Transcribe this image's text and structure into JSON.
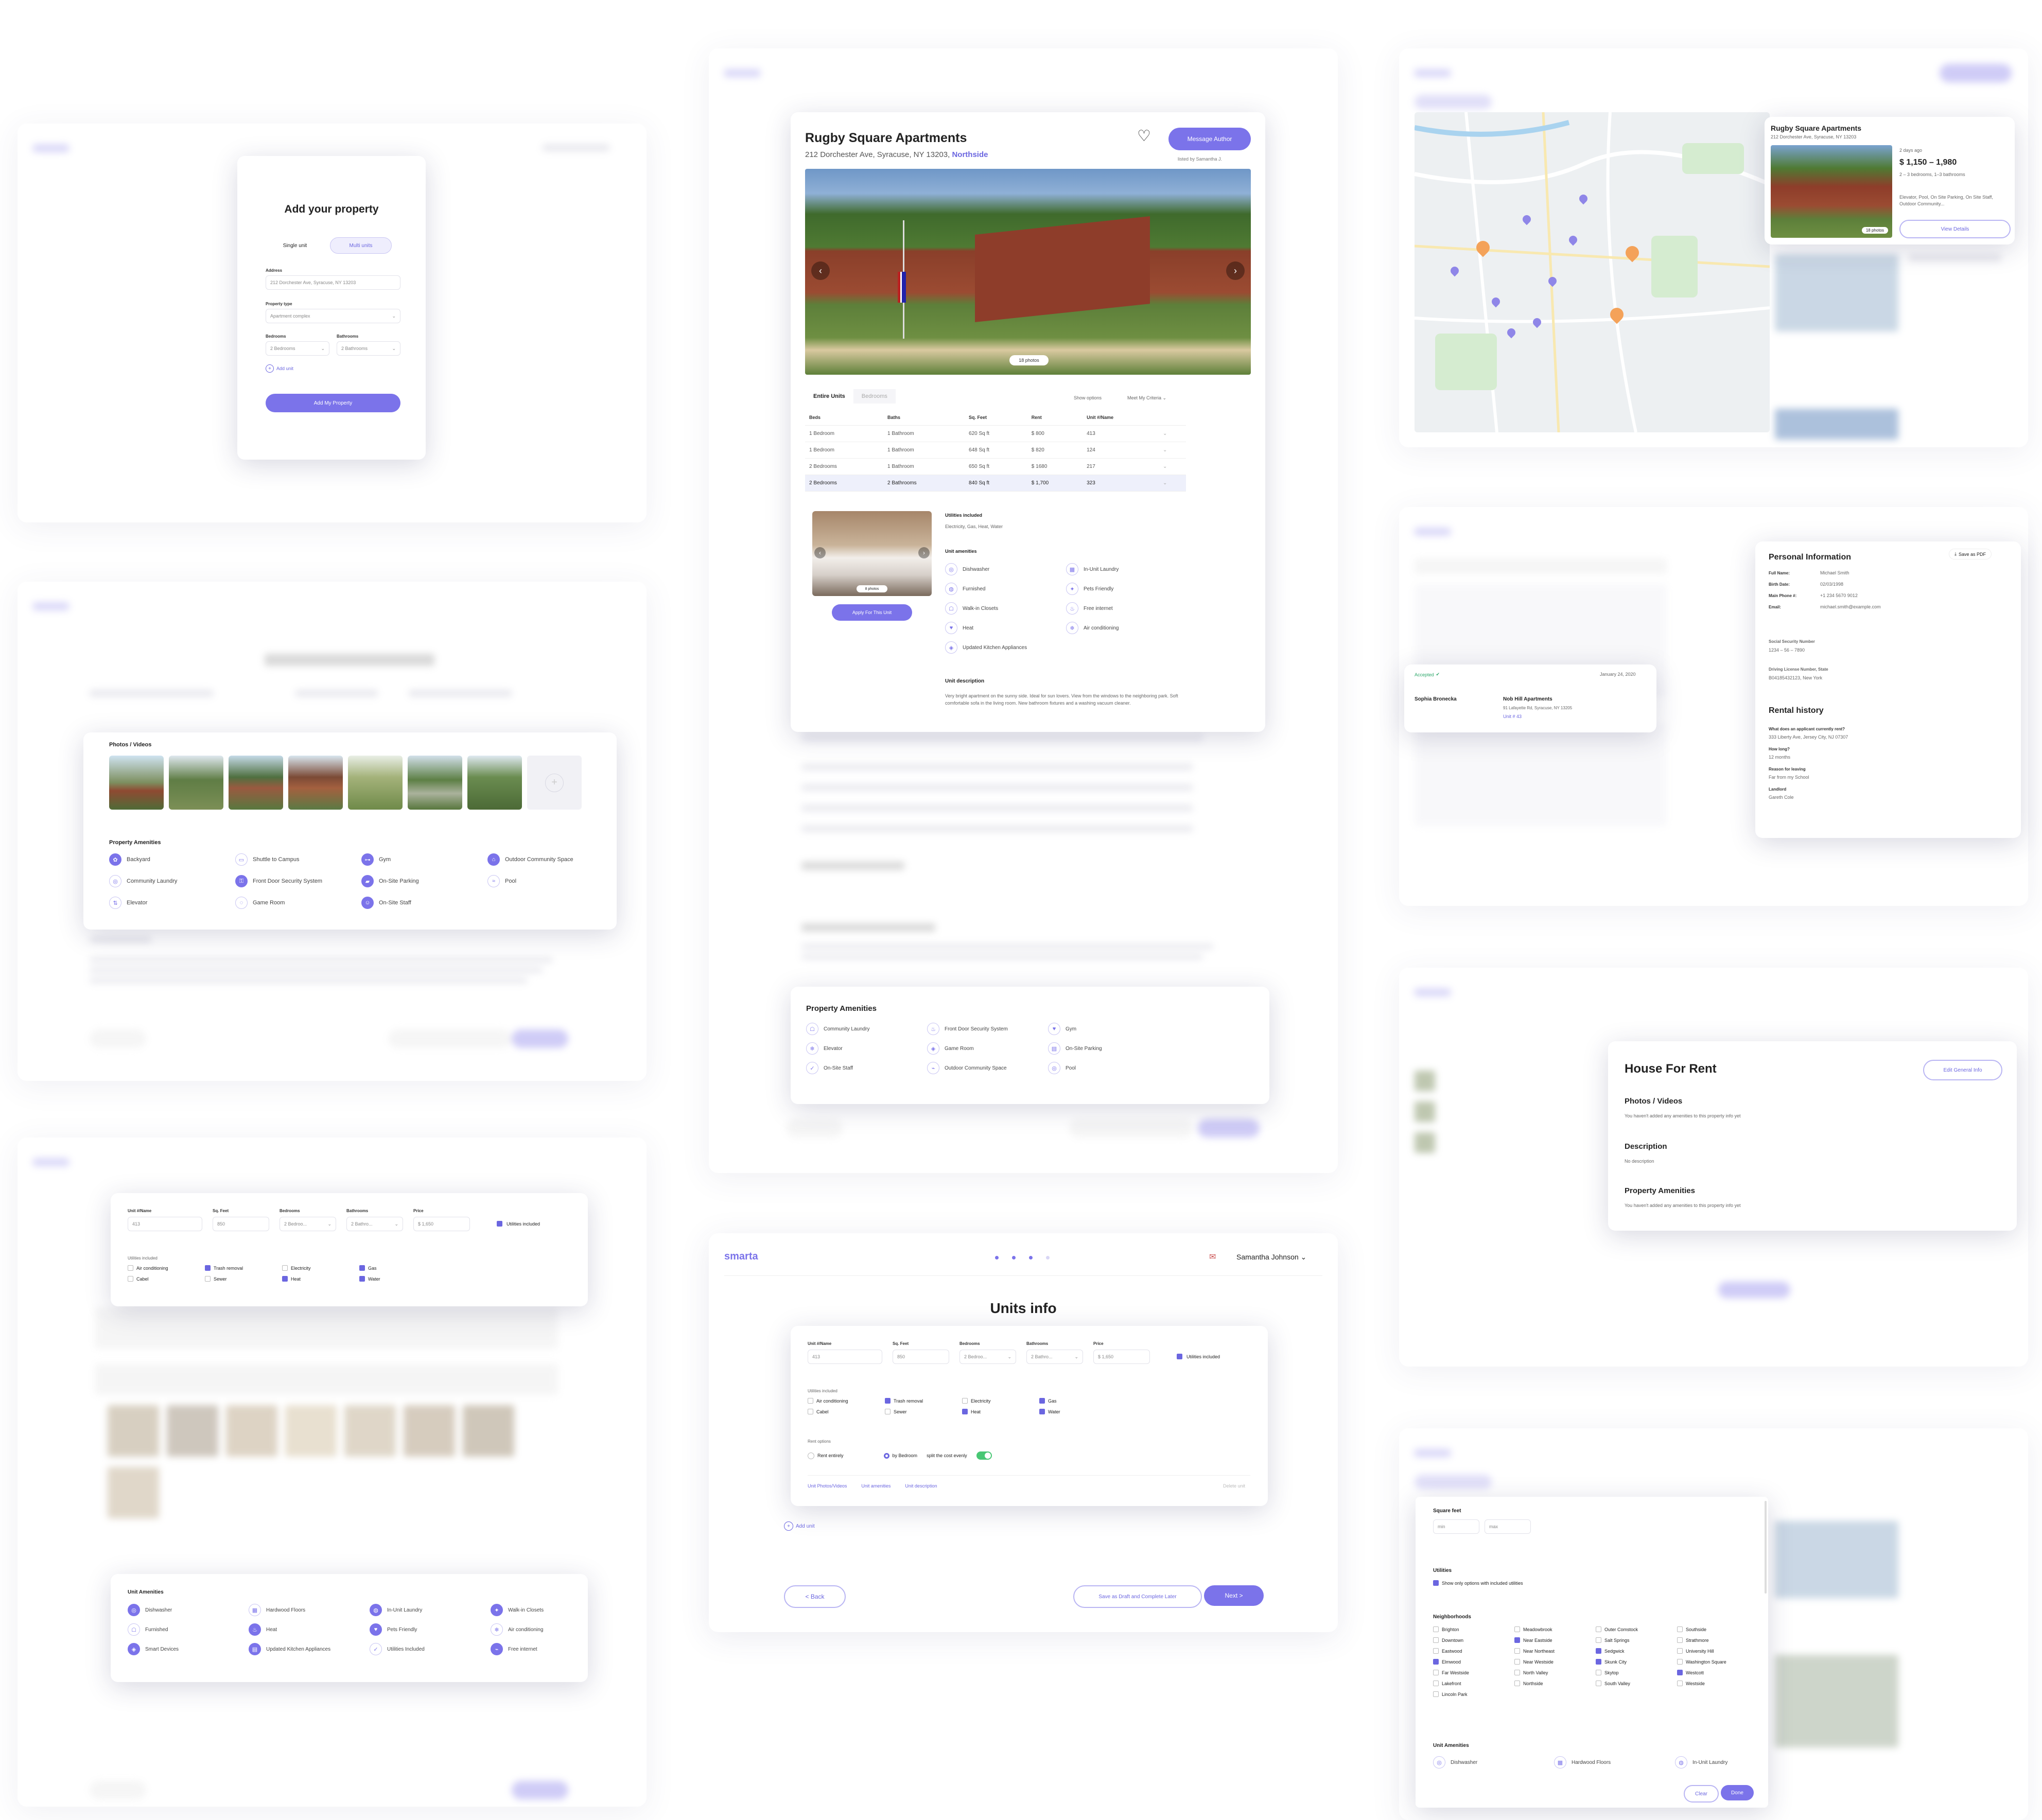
{
  "add_property": {
    "title": "Add your property",
    "tabs": [
      "Single unit",
      "Multi units"
    ],
    "address_label": "Address",
    "address_value": "212 Dorchester Ave, Syracuse, NY 13203",
    "type_label": "Property type",
    "type_value": "Apartment complex",
    "bedrooms_label": "Bedrooms",
    "bedrooms_value": "2 Bedrooms",
    "bathrooms_label": "Bathrooms",
    "bathrooms_value": "2 Bathrooms",
    "add_unit": "Add unit",
    "submit": "Add My Property"
  },
  "general_info": {
    "title": "General Property info",
    "photos_title": "Photos / Videos",
    "amenities_title": "Property Amenities",
    "amenities": [
      "Backyard",
      "Shuttle to Campus",
      "Gym",
      "Outdoor Community Space",
      "Community Laundry",
      "Front Door Security System",
      "On-Site Parking",
      "Pool",
      "Elevator",
      "Game Room",
      "On-Site Staff"
    ]
  },
  "unit_form": {
    "labels": [
      "Unit #/Name",
      "Sq. Feet",
      "Bedrooms",
      "Bathrooms",
      "Price"
    ],
    "values": [
      "413",
      "850",
      "2 Bedroo...",
      "2 Bathro...",
      "$ 1,650"
    ],
    "utilities_checkbox": "Utilities included",
    "utilities_label": "Utilities included",
    "utilities": [
      {
        "name": "Air conditioning",
        "checked": false
      },
      {
        "name": "Trash removal",
        "checked": true
      },
      {
        "name": "Electricity",
        "checked": false
      },
      {
        "name": "Gas",
        "checked": true
      },
      {
        "name": "Cabel",
        "checked": false
      },
      {
        "name": "Sewer",
        "checked": false
      },
      {
        "name": "Heat",
        "checked": true
      },
      {
        "name": "Water",
        "checked": true
      }
    ],
    "unit_amenities_title": "Unit Amenities",
    "unit_amenities": [
      "Dishwasher",
      "Hardwood Floors",
      "In-Unit Laundry",
      "Walk-in Closets",
      "Furnished",
      "Heat",
      "Pets Friendly",
      "Air conditioning",
      "Smart Devices",
      "Updated Kitchen Appliances",
      "Utilities Included",
      "Free internet"
    ]
  },
  "listing": {
    "title": "Rugby Square Apartments",
    "address": "212 Dorchester Ave, Syracuse, NY 13203,",
    "neighborhood": "Northside",
    "message_button": "Message Author",
    "listed_by": "listed by Samantha J.",
    "photo_count": "18 photos",
    "tabs": [
      "Entire Units",
      "Bedrooms"
    ],
    "show_options": "Show options",
    "meet_criteria": "Meet My Criteria",
    "table_headers": [
      "Beds",
      "Baths",
      "Sq. Feet",
      "Rent",
      "Unit #/Name"
    ],
    "table_rows": [
      [
        "1 Bedroom",
        "1 Bathroom",
        "620 Sq ft",
        "$ 800",
        "413"
      ],
      [
        "1 Bedroom",
        "1 Bathroom",
        "648 Sq ft",
        "$ 820",
        "124"
      ],
      [
        "2 Bedrooms",
        "1 Bathroom",
        "650 Sq ft",
        "$ 1680",
        "217"
      ],
      [
        "2 Bedrooms",
        "2 Bathrooms",
        "840 Sq ft",
        "$ 1,700",
        "323"
      ]
    ],
    "utilities_title": "Utilities included",
    "utilities_text": "Electricity, Gas, Heat, Water",
    "unit_amenities_title": "Unit amenities",
    "unit_amenities": [
      "Dishwasher",
      "In-Unit Laundry",
      "Furnished",
      "Pets Friendly",
      "Walk-in Closets",
      "Free internet",
      "Heat",
      "Air conditioning",
      "Updated Kitchen Appliances"
    ],
    "apply_button": "Apply For This Unit",
    "unit_photo_count": "8 photos",
    "description_title": "Unit description",
    "description": "Very bright apartment on the sunny side. Ideal for sun lovers. View from the windows to the neighboring park. Soft comfortable sofa in the living room. New bathroom fixtures and a washing vacuum cleaner.",
    "property_amenities_title": "Property Amenities",
    "property_amenities": [
      "Community Laundry",
      "Front Door Security System",
      "Gym",
      "Elevator",
      "Game Room",
      "On-Site Parking",
      "On-Site Staff",
      "Outdoor Community Space",
      "Pool"
    ]
  },
  "units_info": {
    "brand": "smarta",
    "user": "Samantha Johnson",
    "title": "Units info",
    "rent_options_label": "Rent options",
    "rent_options": [
      "Rent entirely",
      "by Bedroom"
    ],
    "split_label": "split the cost evenly",
    "links": [
      "Unit Photos/Videos",
      "Unit amenities",
      "Unit description"
    ],
    "delete_unit": "Delete unit",
    "add_unit": "Add unit",
    "back": "< Back",
    "save_draft": "Save as Draft and Complete Later",
    "next": "Next >"
  },
  "map_card": {
    "title": "Rugby Square Apartments",
    "address": "212 Dorchester Ave, Syracuse, NY 13203",
    "age": "2 days ago",
    "price": "$ 1,150 – 1,980",
    "beds": "2 – 3 bedrooms, 1–3 bathrooms",
    "features": "Elevator, Pool, On Site Parking, On Site Staff, Outdoor Community...",
    "photos": "18 photos",
    "view_button": "View Details"
  },
  "personal_info": {
    "save_pdf": "Save as PDF",
    "title": "Personal Information",
    "fields": [
      {
        "label": "Full Name:",
        "value": "Michael Smith"
      },
      {
        "label": "Birth Date:",
        "value": "02/03/1998"
      },
      {
        "label": "Main Phone #:",
        "value": "+1 234 5670 9012"
      },
      {
        "label": "Email:",
        "value": "michael.smith@example.com"
      }
    ],
    "ssn_label": "Social Security Number",
    "ssn_value": "1234 – 56 – 7890",
    "license_label": "Driving License Number, State",
    "license_value": "B04185432123, New York",
    "rental_title": "Rental history",
    "rental": [
      {
        "label": "What does an applicant currently rent?",
        "value": "333 Liberty Ave, Jersey City, NJ 07307"
      },
      {
        "label": "How long?",
        "value": "12 months"
      },
      {
        "label": "Reason for leaving",
        "value": "Far from my School"
      },
      {
        "label": "Landlord",
        "value": "Gareth Cole"
      }
    ],
    "application": {
      "status": "Accepted",
      "date": "January 24, 2020",
      "applicant": "Sophia Bronecka",
      "property": "Nob Hill Apartments",
      "property_address": "91 Lafayette Rd, Syracuse, NY 13205",
      "unit": "Unit # 43"
    }
  },
  "house_for_rent": {
    "title": "House For Rent",
    "edit_button": "Edit General Info",
    "photos_title": "Photos / Videos",
    "photos_text": "You haven't added any amenities to this property info yet",
    "description_title": "Description",
    "description_text": "No description",
    "amenities_title": "Property Amenities",
    "amenities_text": "You haven't added any amenities to this property info yet"
  },
  "filters": {
    "sqft_title": "Square feet",
    "sqft_min": "min",
    "sqft_max": "max",
    "utilities_title": "Utilities",
    "utilities_option": "Show only options with included utilities",
    "neighborhoods_title": "Neighborhoods",
    "neighborhoods": [
      {
        "name": "Brighton",
        "checked": false
      },
      {
        "name": "Meadowbrook",
        "checked": false
      },
      {
        "name": "Outer Comstock",
        "checked": false
      },
      {
        "name": "Southside",
        "checked": false
      },
      {
        "name": "Downtown",
        "checked": false
      },
      {
        "name": "Near Eastside",
        "checked": true
      },
      {
        "name": "Salt Springs",
        "checked": false
      },
      {
        "name": "Strathmore",
        "checked": false
      },
      {
        "name": "Eastwood",
        "checked": false
      },
      {
        "name": "Near Northeast",
        "checked": false
      },
      {
        "name": "Sedgwick",
        "checked": true
      },
      {
        "name": "University Hill",
        "checked": false
      },
      {
        "name": "Elmwood",
        "checked": true
      },
      {
        "name": "Near Westside",
        "checked": false
      },
      {
        "name": "Skunk City",
        "checked": true
      },
      {
        "name": "Washington Square",
        "checked": false
      },
      {
        "name": "Far Westside",
        "checked": false
      },
      {
        "name": "North Valley",
        "checked": false
      },
      {
        "name": "Skytop",
        "checked": false
      },
      {
        "name": "Westcott",
        "checked": true
      },
      {
        "name": "Lakefront",
        "checked": false
      },
      {
        "name": "Northside",
        "checked": false
      },
      {
        "name": "South Valley",
        "checked": false
      },
      {
        "name": "Westside",
        "checked": false
      },
      {
        "name": "Lincoln Park",
        "checked": false
      }
    ],
    "unit_amenities_title": "Unit Amenities",
    "unit_amenities": [
      "Dishwasher",
      "Hardwood Floors",
      "In-Unit Laundry"
    ],
    "clear": "Clear",
    "done": "Done"
  },
  "colors": {
    "accent": "#7b73ea",
    "accent_dark": "#6b66e0",
    "map_pin_orange": "#f4a259"
  }
}
